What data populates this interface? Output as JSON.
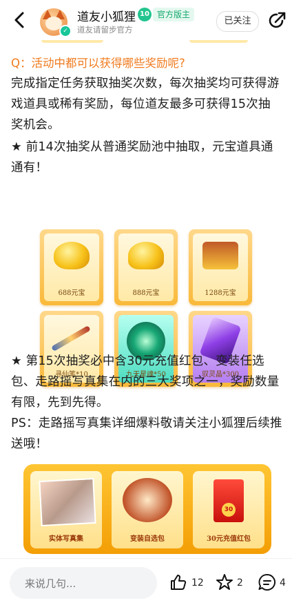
{
  "header": {
    "username": "道友小狐狸",
    "level": "10",
    "badge": "官方版主",
    "subtitle": "道友请留步官方",
    "follow_label": "已关注"
  },
  "post": {
    "question": "Q：活动中都可以获得哪些奖励呢?",
    "para1": "完成指定任务获取抽奖次数，每次抽奖均可获得游戏道具或稀有奖励，每位道友最多可获得15次抽奖机会。",
    "para2": "★ 前14次抽奖从普通奖励池中抽取，元宝道具通通有！",
    "para3": "★ 第15次抽奖必中含30元充值红包、变装任选包、走路摇写真集在内的三大奖项之一，奖励数量有限，先到先得。",
    "para4": "PS：走路摇写真集详细爆料敬请关注小狐狸后续推送哦！"
  },
  "prizes": [
    {
      "label": "688元宝"
    },
    {
      "label": "888元宝"
    },
    {
      "label": "1288元宝"
    },
    {
      "label": "寻仙笔*10"
    },
    {
      "label": "九天星魂*50"
    },
    {
      "label": "驭灵晶*300"
    }
  ],
  "grand_prizes": [
    {
      "label": "实体写真集"
    },
    {
      "label": "变装自选包"
    },
    {
      "label": "30元充值红包"
    }
  ],
  "red_envelope_amount": "30",
  "bottombar": {
    "comment_placeholder": "来说几句...",
    "likes": "12",
    "favorites": "2",
    "comments": "4"
  },
  "colors": {
    "accent": "#f07b1f",
    "official_green": "#15a86e",
    "gold": "#f9b93a"
  },
  "icons": [
    "back-arrow-icon",
    "verified-icon",
    "share-icon",
    "like-icon",
    "star-icon",
    "comment-icon"
  ]
}
